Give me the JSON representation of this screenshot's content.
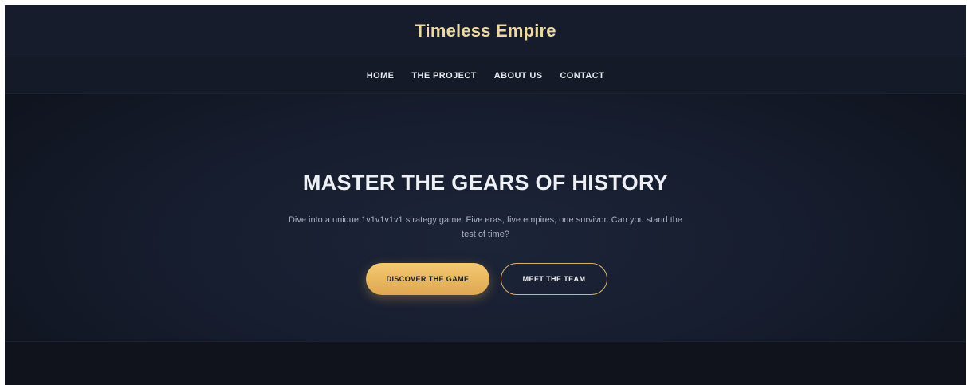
{
  "header": {
    "title": "Timeless Empire"
  },
  "nav": {
    "items": [
      {
        "label": "HOME"
      },
      {
        "label": "THE PROJECT"
      },
      {
        "label": "ABOUT US"
      },
      {
        "label": "CONTACT"
      }
    ]
  },
  "hero": {
    "title": "MASTER THE GEARS OF HISTORY",
    "subtitle": "Dive into a unique 1v1v1v1v1 strategy game. Five eras, five empires, one survivor. Can you stand the test of time?",
    "primary_button": "DISCOVER THE GAME",
    "secondary_button": "MEET THE TEAM"
  },
  "colors": {
    "background": "#11141d",
    "header_bg": "#171c2c",
    "title_gold": "#ecd9a4",
    "accent_gold": "#dfa752",
    "text_light": "#eef0f5",
    "text_muted": "#aab1c2"
  }
}
